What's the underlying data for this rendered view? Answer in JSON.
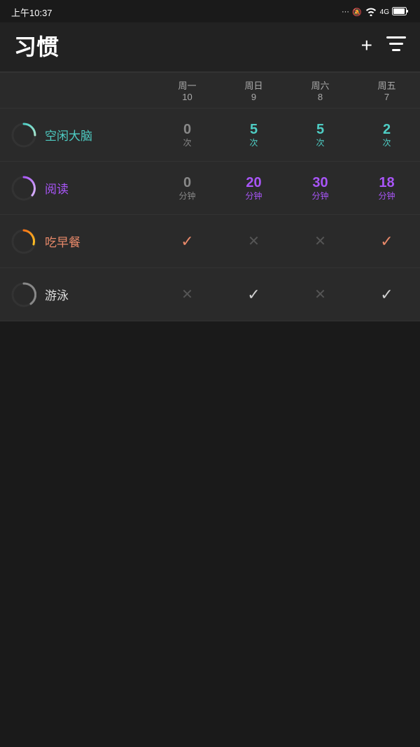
{
  "statusBar": {
    "time": "上午10:37",
    "icons": "··· 🔕 ✦ 4G ⚡"
  },
  "header": {
    "title": "习惯",
    "addBtn": "+",
    "filterBtn": "≡"
  },
  "columns": {
    "days": [
      {
        "label": "周一",
        "num": "10"
      },
      {
        "label": "周日",
        "num": "9"
      },
      {
        "label": "周六",
        "num": "8"
      },
      {
        "label": "周五",
        "num": "7"
      }
    ]
  },
  "habits": [
    {
      "name": "空闲大脑",
      "iconColor": "teal-gradient",
      "cells": [
        {
          "type": "empty",
          "value": "0",
          "unit": "次"
        },
        {
          "type": "value",
          "value": "5",
          "unit": "次",
          "color": "green"
        },
        {
          "type": "value",
          "value": "5",
          "unit": "次",
          "color": "green"
        },
        {
          "type": "value",
          "value": "2",
          "unit": "次",
          "color": "green"
        }
      ]
    },
    {
      "name": "阅读",
      "iconColor": "purple-gradient",
      "cells": [
        {
          "type": "empty",
          "value": "0",
          "unit": "分钟"
        },
        {
          "type": "value",
          "value": "20",
          "unit": "分钟",
          "color": "purple"
        },
        {
          "type": "value",
          "value": "30",
          "unit": "分钟",
          "color": "purple"
        },
        {
          "type": "value",
          "value": "18",
          "unit": "分钟",
          "color": "purple"
        }
      ]
    },
    {
      "name": "吃早餐",
      "iconColor": "orange-gradient",
      "cells": [
        {
          "type": "check"
        },
        {
          "type": "cross"
        },
        {
          "type": "cross"
        },
        {
          "type": "check"
        }
      ]
    },
    {
      "name": "游泳",
      "iconColor": "gray-gradient",
      "cells": [
        {
          "type": "cross"
        },
        {
          "type": "check-white"
        },
        {
          "type": "cross"
        },
        {
          "type": "check-white"
        }
      ]
    }
  ]
}
